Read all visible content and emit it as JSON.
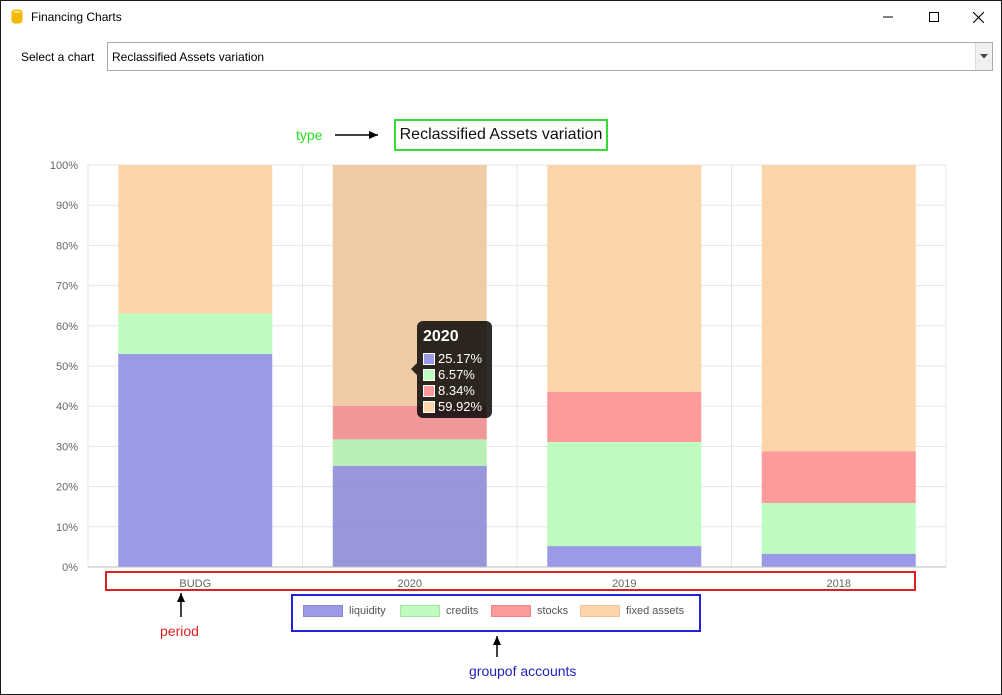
{
  "window": {
    "title": "Financing Charts",
    "icon": "database-icon"
  },
  "controls": {
    "select_label": "Select a chart",
    "select_value": "Reclassified Assets variation"
  },
  "annotations": {
    "type": "type",
    "period": "period",
    "group": "groupof accounts"
  },
  "colors": {
    "liquidity": "#9b9ae6",
    "credits": "#bdfcbe",
    "stocks": "#fd9b9c",
    "fixed_assets": "#fdd5aa",
    "annotation_green": "#22dd22",
    "annotation_red": "#e02020",
    "annotation_blue": "#2222bb"
  },
  "tooltip": {
    "title": "2020",
    "rows": [
      "25.17%",
      "6.57%",
      "8.34%",
      "59.92%"
    ]
  },
  "chart_data": {
    "type": "bar",
    "stacked": true,
    "title": "Reclassified Assets variation",
    "categories": [
      "BUDG",
      "2020",
      "2019",
      "2018"
    ],
    "series": [
      {
        "name": "liquidity",
        "values": [
          53.0,
          25.17,
          5.2,
          3.3
        ]
      },
      {
        "name": "credits",
        "values": [
          10.1,
          6.57,
          25.9,
          12.6
        ]
      },
      {
        "name": "stocks",
        "values": [
          0.0,
          8.34,
          12.5,
          12.9
        ]
      },
      {
        "name": "fixed assets",
        "values": [
          36.9,
          59.92,
          56.4,
          71.2
        ]
      }
    ],
    "ylim": [
      0,
      100
    ],
    "yticks": [
      "0%",
      "10%",
      "20%",
      "30%",
      "40%",
      "50%",
      "60%",
      "70%",
      "80%",
      "90%",
      "100%"
    ],
    "grid": true,
    "legend_position": "bottom"
  }
}
